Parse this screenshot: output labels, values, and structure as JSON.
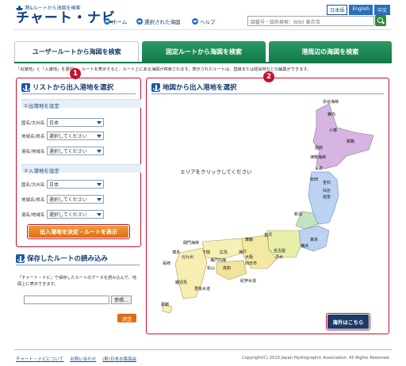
{
  "header": {
    "tagline": "港&ルートから海図を検索",
    "logo": "チャート・ナビ",
    "nav": [
      {
        "label": "ホーム"
      },
      {
        "label": "選択された海図"
      },
      {
        "label": "ヘルプ"
      }
    ],
    "languages": [
      {
        "label": "日本語"
      },
      {
        "label": "English"
      },
      {
        "label": "中文"
      }
    ],
    "search_value": "図番号・図名検索：W90 東京湾"
  },
  "tabs": [
    {
      "label": "ユーザールートから海図を検索"
    },
    {
      "label": "固定ルートから海図を検索"
    },
    {
      "label": "港周辺の海図を検索"
    }
  ],
  "description": "「出港地」と「入港地」を選択し、ルートを表示すると、ルート上にある海図が検索されます。表示されたルートは、直線または経由地などの編集ができます。",
  "left_panel": {
    "badge": "1",
    "title": "リストから出入港地を選択",
    "departure": {
      "title": "①出港地を設定",
      "rows": [
        {
          "label": "国名/大州名",
          "value": "日本"
        },
        {
          "label": "地域名/県名",
          "value": "選択してください"
        },
        {
          "label": "港名/地域名",
          "value": "選択してください"
        }
      ]
    },
    "arrival": {
      "title": "②入港地を設定",
      "rows": [
        {
          "label": "国名/大州名",
          "value": "日本"
        },
        {
          "label": "地域名/県名",
          "value": "選択してください"
        },
        {
          "label": "港名/地域名",
          "value": "選択してください"
        }
      ]
    },
    "submit": "出入港地を決定・ルートを表示"
  },
  "saved": {
    "title": "保存したルートの読み込み",
    "desc": "「チャート・ナビ」で保存したルートのデータを読み込んで、地図上に表示できます。",
    "browse": "参照...",
    "decide": "決定"
  },
  "map_panel": {
    "badge": "2",
    "title": "地図から出入港地を選択",
    "hint": "エリアをクリックしてください",
    "overseas": "海外はこちら",
    "regions": [
      "宗谷海峡",
      "稚内",
      "小樽",
      "釧路",
      "函館",
      "津軽海峡",
      "青森",
      "秋田",
      "釜石",
      "仙台",
      "塩釜",
      "新潟",
      "東京",
      "横浜",
      "舞鶴",
      "金沢",
      "名古屋",
      "清水",
      "関門海峡",
      "博多",
      "北九州",
      "下関",
      "広島",
      "神戸",
      "大阪",
      "四日市",
      "瀬戸内海",
      "松山",
      "高知",
      "紀伊水道",
      "長崎",
      "鹿児島",
      "豊後水道",
      "那覇"
    ]
  },
  "footer": {
    "links": [
      {
        "label": "チャート・ナビについて"
      },
      {
        "label": "お問い合わせ"
      },
      {
        "label": "(財)日本水路協会"
      }
    ],
    "copyright": "Copyright(C) 2010 Japan Hydrographic Association. All Rights Reserved."
  },
  "colors": {
    "tab_green": "#137a48",
    "accent_red": "#c8102e",
    "navy": "#123a6b",
    "orange": "#e06c12"
  }
}
